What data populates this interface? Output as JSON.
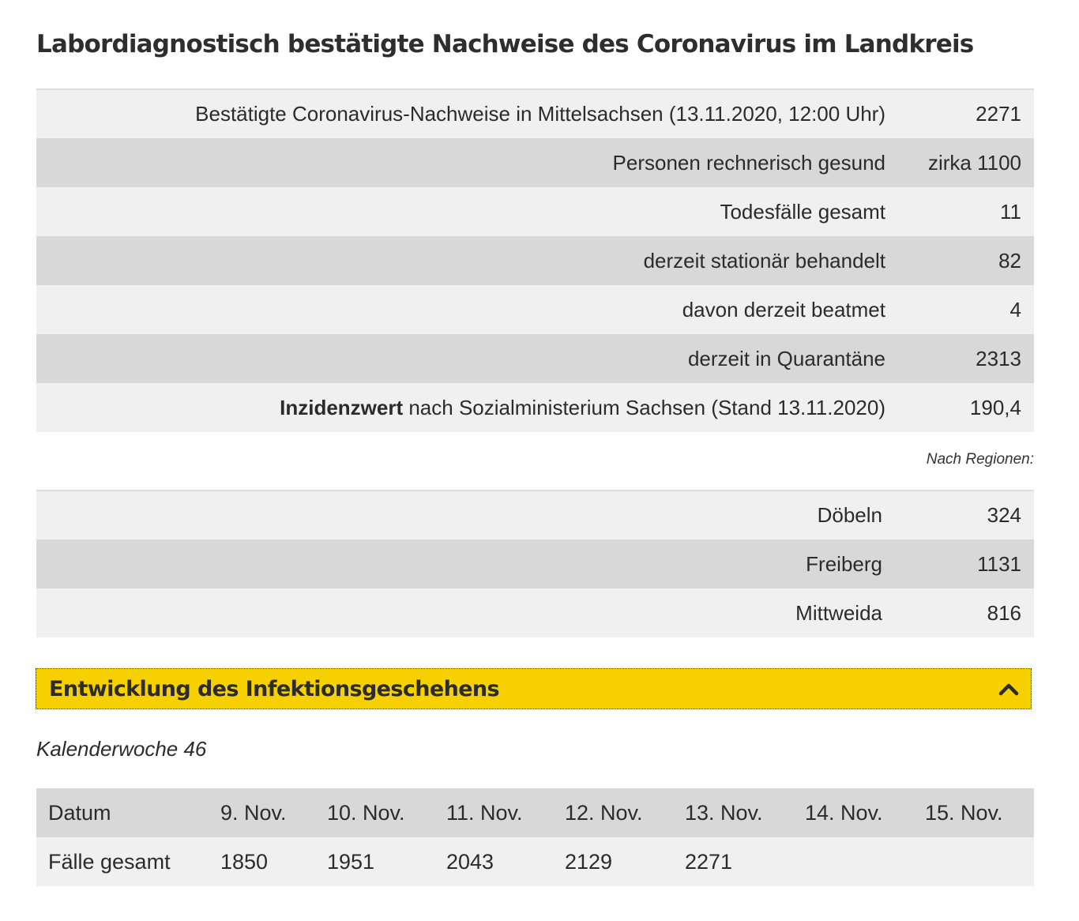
{
  "page": {
    "title": "Labordiagnostisch bestätigte Nachweise des Coronavirus im Landkreis"
  },
  "stats": [
    {
      "label": "Bestätigte Coronavirus-Nachweise in Mittelsachsen (13.11.2020, 12:00 Uhr)",
      "value": "2271"
    },
    {
      "label": "Personen rechnerisch gesund",
      "value": "zirka 1100"
    },
    {
      "label": "Todesfälle gesamt",
      "value": "11"
    },
    {
      "label": "derzeit stationär behandelt",
      "value": "82"
    },
    {
      "label": "davon derzeit beatmet",
      "value": "4"
    },
    {
      "label": "derzeit in Quarantäne",
      "value": "2313"
    },
    {
      "label_bold": "Inzidenzwert",
      "label": " nach Sozialministerium Sachsen (Stand 13.11.2020)",
      "value": "190,4"
    }
  ],
  "regions": {
    "caption": "Nach Regionen:",
    "rows": [
      {
        "label": "Döbeln",
        "value": "324"
      },
      {
        "label": "Freiberg",
        "value": "1131"
      },
      {
        "label": "Mittweida",
        "value": "816"
      }
    ]
  },
  "accordion": {
    "title": "Entwicklung des Infektionsgeschehens",
    "icon": "chevron-up-icon",
    "expanded": true
  },
  "week": {
    "label": "Kalenderwoche 46",
    "header": [
      "Datum",
      "9. Nov.",
      "10. Nov.",
      "11. Nov.",
      "12. Nov.",
      "13. Nov.",
      "14. Nov.",
      "15. Nov."
    ],
    "row": [
      "Fälle gesamt",
      "1850",
      "1951",
      "2043",
      "2129",
      "2271",
      "",
      ""
    ]
  },
  "colors": {
    "accent_yellow": "#f7d000",
    "row_light": "#f0f0f0",
    "row_dark": "#d8d8d8"
  }
}
